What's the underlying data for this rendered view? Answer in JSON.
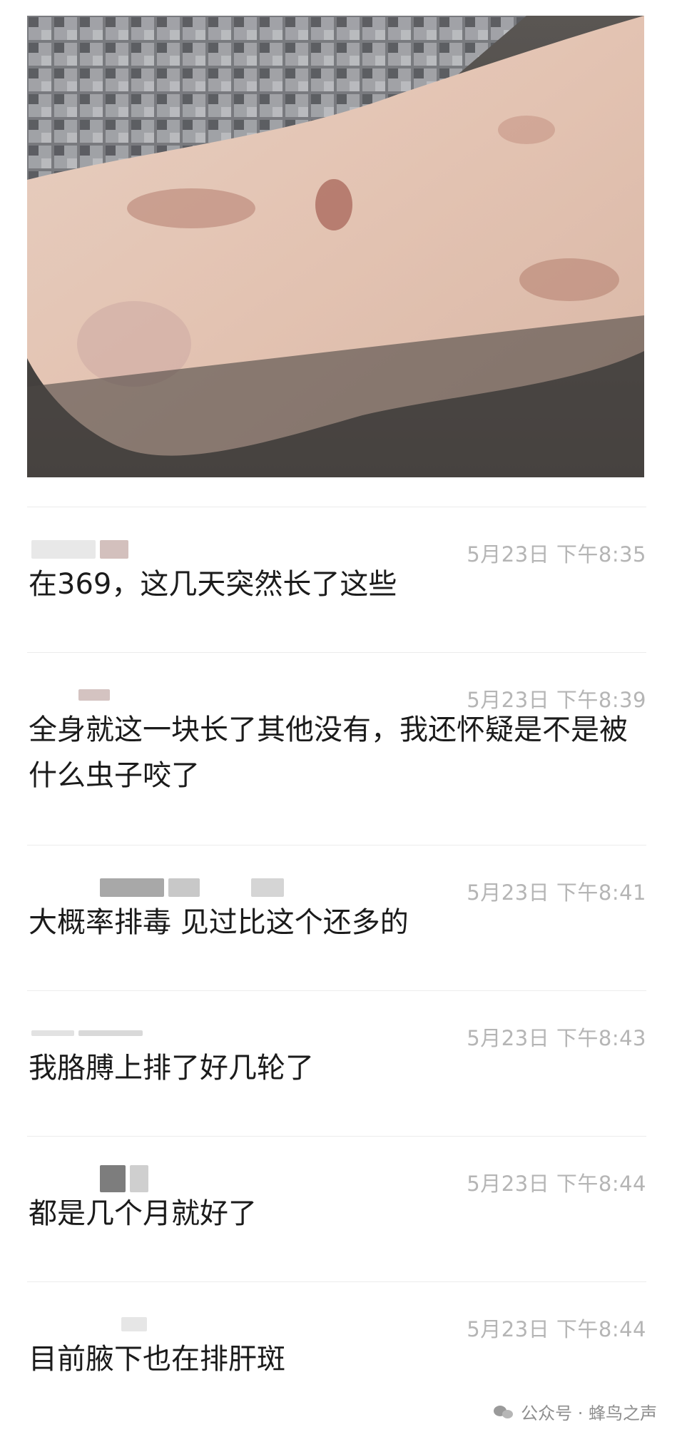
{
  "comments": [
    {
      "time": "5月23日 下午8:35",
      "text": "在369，这几天突然长了这些"
    },
    {
      "time": "5月23日 下午8:39",
      "text": "全身就这一块长了其他没有，我还怀疑是不是被什么虫子咬了"
    },
    {
      "time": "5月23日 下午8:41",
      "text": "大概率排毒 见过比这个还多的"
    },
    {
      "time": "5月23日 下午8:43",
      "text": "我胳膊上排了好几轮了"
    },
    {
      "time": "5月23日 下午8:44",
      "text": "都是几个月就好了"
    },
    {
      "time": "5月23日 下午8:44",
      "text": "目前腋下也在排肝斑"
    }
  ],
  "watermark": {
    "text": "公众号 · 蜂鸟之声"
  },
  "colors": {
    "time": "#b5b5b5",
    "text": "#1b1b1b",
    "divider": "#ececec"
  }
}
